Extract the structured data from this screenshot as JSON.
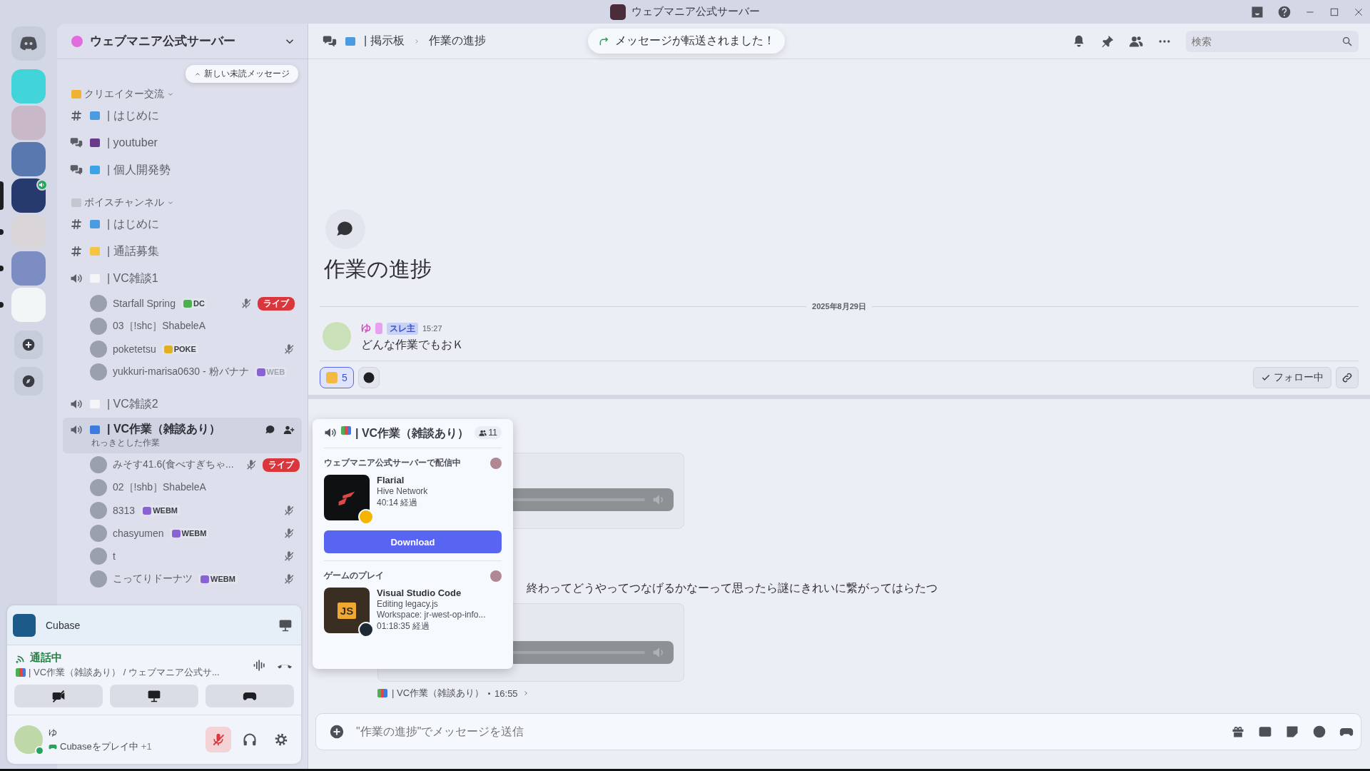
{
  "window": {
    "title": "ウェブマニア公式サーバー"
  },
  "servers": [
    {
      "selected": false,
      "unread": false,
      "voice": false
    },
    {
      "selected": false,
      "unread": false,
      "voice": false
    },
    {
      "selected": false,
      "unread": false,
      "voice": false
    },
    {
      "selected": true,
      "unread": false,
      "voice": true
    },
    {
      "selected": false,
      "unread": true,
      "voice": false
    },
    {
      "selected": false,
      "unread": true,
      "voice": false
    },
    {
      "selected": false,
      "unread": true,
      "voice": false
    }
  ],
  "sidebar": {
    "server_name": "ウェブマニア公式サーバー",
    "unread_pill": "新しい未読メッセージ",
    "categories": [
      {
        "name": "クリエイター交流",
        "color": "#f0b232",
        "expanded": true,
        "channels": [
          {
            "kind": "text",
            "color": "#4a9be0",
            "name": "| はじめに",
            "selected": false
          },
          {
            "kind": "forum",
            "color": "#6a3a8a",
            "name": "| youtuber",
            "selected": false
          },
          {
            "kind": "forum",
            "color": "#3ba3e8",
            "name": "| 個人開発勢",
            "selected": false
          }
        ]
      },
      {
        "name": "ボイスチャンネル",
        "color": "#c4c7cf",
        "expanded": true,
        "channels": [
          {
            "kind": "text",
            "color": "#4a9be0",
            "name": "| はじめに",
            "selected": false
          },
          {
            "kind": "text",
            "color": "#f5c542",
            "name": "| 通話募集",
            "selected": false
          },
          {
            "kind": "voice",
            "color": "#f4f5f8",
            "name": "| VC雑談1",
            "selected": false,
            "members": [
              {
                "name": "Starfall Spring",
                "tag": "DC",
                "color": "#4caf50",
                "muted": true,
                "live": "ライブ"
              },
              {
                "name": "03［!shc］ShabeleA",
                "muted": false
              },
              {
                "name": "poketetsu",
                "tag": "POKE",
                "color": "#e0b020",
                "muted": true
              },
              {
                "name": "yukkuri-marisa0630 - 粉バナナ",
                "tag": "WEB",
                "color": "#8a63d2",
                "muted": false
              }
            ]
          },
          {
            "kind": "voice",
            "color": "#f4f5f8",
            "name": "| VC雑談2",
            "selected": false
          },
          {
            "kind": "voice",
            "color": "#3d7be0",
            "name": "| VC作業（雑談あり）",
            "selected": true,
            "subtitle": "れっきとした作業",
            "members": [
              {
                "name": "みそす41.6(食べすぎちゃ...",
                "muted": true,
                "live": "ライブ"
              },
              {
                "name": "02［!shb］ShabeleA",
                "muted": false
              },
              {
                "name": "8313",
                "tag": "WEBM",
                "color": "#8a63d2",
                "muted": true
              },
              {
                "name": "chasyumen",
                "tag": "WEBM",
                "color": "#8a63d2",
                "muted": true
              },
              {
                "name": "t",
                "muted": true
              },
              {
                "name": "こってりドーナツ",
                "tag": "WEBM",
                "color": "#8a63d2",
                "muted": true
              }
            ]
          }
        ]
      }
    ]
  },
  "user_panel": {
    "activity": "Cubase",
    "voice_status": "通話中",
    "voice_channel": "| VC作業（雑談あり） / ウェブマニア公式サ...",
    "user": {
      "name": "ゆ",
      "status": "Cubaseをプレイ中",
      "extra": "+1",
      "muted": true,
      "online": true
    }
  },
  "topbar": {
    "breadcrumb": [
      "| 掲示板",
      "作業の進捗"
    ],
    "toast": "メッセージが転送されました！",
    "search": {
      "placeholder": "検索"
    }
  },
  "thread": {
    "title": "作業の進捗",
    "date": "2025年8月29日",
    "message": {
      "author": "ゆ",
      "badge": "スレ主",
      "time": "15:27",
      "text": "どんな作業でもおＫ",
      "reactions": [
        {
          "count": "5",
          "selected": true
        }
      ],
      "following": true,
      "follow_label": "フォロー中"
    },
    "reply": {
      "text": "終わってどうやってつなげるかなーって思ったら謎にきれいに繋がってはらたつ",
      "attachments": [
        {
          "kind": "audio"
        },
        {
          "kind": "audio"
        }
      ],
      "thread_name": "| VC作業（雑談あり）",
      "thread_time": "16:55"
    }
  },
  "popup": {
    "title": "| VC作業（雑談あり）",
    "count": "11",
    "sections": [
      {
        "heading": "ウェブマニア公式サーバーで配信中",
        "app": "Flarial",
        "kind": "flarial",
        "lines": [
          "Hive Network",
          "40:14 経過"
        ],
        "button": "Download"
      },
      {
        "heading": "ゲームのプレイ",
        "app": "Visual Studio Code",
        "kind": "vscode",
        "tile_text": "JS",
        "lines": [
          "Editing legacy.js",
          "Workspace: jr-west-op-info...",
          "01:18:35 経過"
        ]
      }
    ]
  },
  "composer": {
    "placeholder": "\"作業の進捗\"でメッセージを送信"
  }
}
